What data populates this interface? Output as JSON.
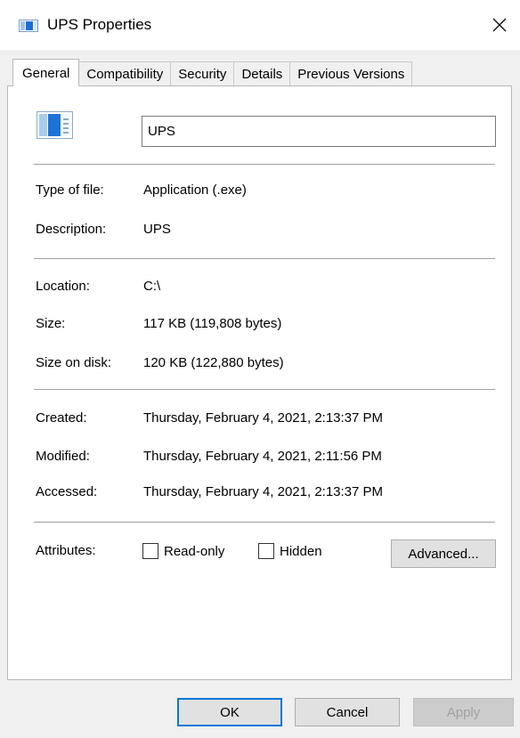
{
  "window": {
    "title": "UPS Properties",
    "icon": "application-window-icon"
  },
  "tabs": [
    {
      "label": "General",
      "active": true
    },
    {
      "label": "Compatibility",
      "active": false
    },
    {
      "label": "Security",
      "active": false
    },
    {
      "label": "Details",
      "active": false
    },
    {
      "label": "Previous Versions",
      "active": false
    }
  ],
  "general": {
    "file_name": "UPS",
    "type_of_file": {
      "label": "Type of file:",
      "value": "Application (.exe)"
    },
    "description": {
      "label": "Description:",
      "value": "UPS"
    },
    "location": {
      "label": "Location:",
      "value": "C:\\"
    },
    "size": {
      "label": "Size:",
      "value": "117 KB (119,808 bytes)"
    },
    "size_on_disk": {
      "label": "Size on disk:",
      "value": "120 KB (122,880 bytes)"
    },
    "created": {
      "label": "Created:",
      "value": "Thursday, February 4, 2021, 2:13:37 PM"
    },
    "modified": {
      "label": "Modified:",
      "value": "Thursday, February 4, 2021, 2:11:56 PM"
    },
    "accessed": {
      "label": "Accessed:",
      "value": "Thursday, February 4, 2021, 2:13:37 PM"
    },
    "attributes": {
      "label": "Attributes:",
      "read_only": {
        "label": "Read-only",
        "checked": false
      },
      "hidden": {
        "label": "Hidden",
        "checked": false
      },
      "advanced_label": "Advanced..."
    }
  },
  "buttons": {
    "ok": "OK",
    "cancel": "Cancel",
    "apply": "Apply"
  },
  "colors": {
    "accent": "#0078d7",
    "panel_bg": "#ffffff",
    "dialog_bg": "#f0f0f0"
  }
}
